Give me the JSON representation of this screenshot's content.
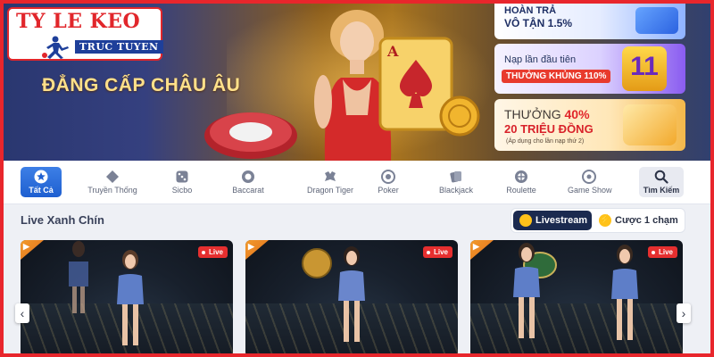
{
  "logo": {
    "title": "TY LE KEO",
    "subtitle": "TRUC TUYEN"
  },
  "hero": {
    "tagline": "ĐẲNG CẤP CHÂU ÂU",
    "promos": [
      {
        "line1": "HOÀN TRẢ",
        "line2": "VÔ TẬN 1.5%"
      },
      {
        "line1": "Nạp lần đầu tiên",
        "line2": "THƯỞNG KHỦNG 110%",
        "badge": "11"
      },
      {
        "line1_prefix": "THƯỞNG ",
        "line1_highlight": "40%",
        "line2": "20 TRIỆU ĐỒNG",
        "note": "(Áp dụng cho lần nạp thứ 2)"
      }
    ]
  },
  "nav": {
    "items": [
      {
        "label": "Tất Cả",
        "icon": "star-icon",
        "active": true
      },
      {
        "label": "Truyền Thống",
        "icon": "diamond-icon"
      },
      {
        "label": "Sicbo",
        "icon": "dice-icon"
      },
      {
        "label": "Baccarat",
        "icon": "chip-icon"
      },
      {
        "label": "Dragon Tiger",
        "icon": "dragon-icon"
      },
      {
        "label": "Poker",
        "icon": "poker-chip-icon"
      },
      {
        "label": "Blackjack",
        "icon": "cards-icon"
      },
      {
        "label": "Roulette",
        "icon": "roulette-icon"
      },
      {
        "label": "Game Show",
        "icon": "wheel-icon"
      },
      {
        "label": "Tìm Kiếm",
        "icon": "search-icon"
      }
    ]
  },
  "section": {
    "title": "Live Xanh Chín",
    "toggle": {
      "livestream": "Livestream",
      "one_touch": "Cược 1 chạm"
    }
  },
  "cards": [
    {
      "badge": "Live"
    },
    {
      "badge": "Live"
    },
    {
      "badge": "Live"
    }
  ],
  "arrows": {
    "prev": "‹",
    "next": "›"
  },
  "colors": {
    "frame": "#e8262c",
    "accent": "#1e5fd0",
    "live": "#e62f2f",
    "navy": "#1b2a4f",
    "gold": "#ffe08a"
  }
}
